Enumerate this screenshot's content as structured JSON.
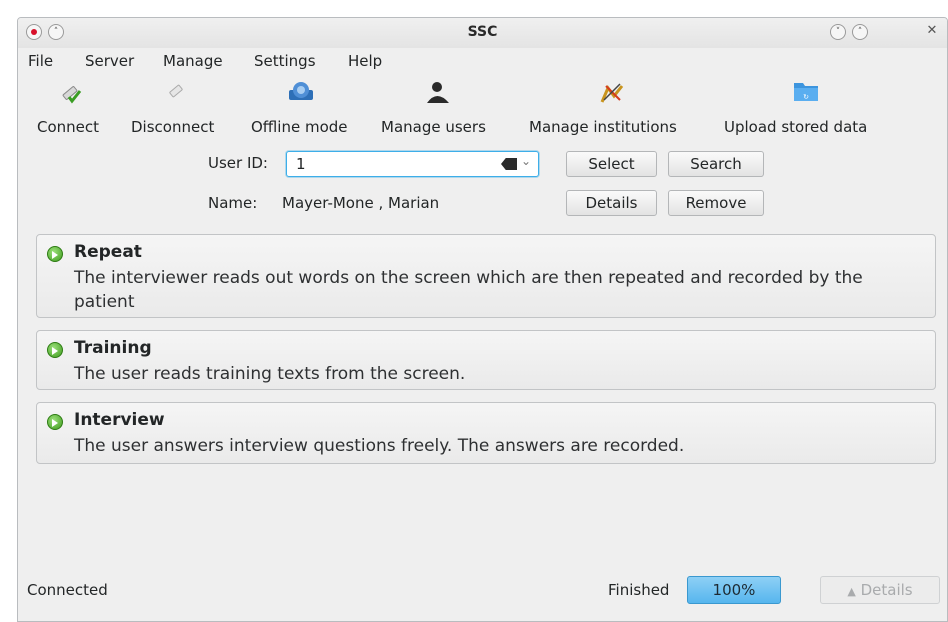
{
  "window": {
    "title": "SSC"
  },
  "menu": [
    {
      "label": "File",
      "underline": "F",
      "rest": "ile"
    },
    {
      "label": "Server",
      "underline": "e",
      "pre": "S",
      "rest": "rver"
    },
    {
      "label": "Manage",
      "underline": "M",
      "rest": "anage"
    },
    {
      "label": "Settings",
      "underline": "S",
      "rest": "ettings"
    },
    {
      "label": "Help",
      "underline": "H",
      "rest": "elp"
    }
  ],
  "toolbar": {
    "connect": "Connect",
    "disconnect": "Disconnect",
    "offline_mode": "Offline mode",
    "manage_users": "Manage users",
    "manage_institutions": "Manage institutions",
    "upload_stored_data": "Upload stored data"
  },
  "user": {
    "id_label": "User ID:",
    "id_value": "1",
    "name_label": "Name:",
    "name_value": "Mayer-Mone , Marian",
    "select_label": "Select",
    "search_label": "Search",
    "details_label": "Details",
    "remove_label": "Remove"
  },
  "tasks": [
    {
      "title": "Repeat",
      "description": "The interviewer reads out words on the screen which are then repeated and recorded by the patient"
    },
    {
      "title": "Training",
      "description": "The user reads training texts from the screen."
    },
    {
      "title": "Interview",
      "description": "The user answers interview questions freely. The answers are recorded."
    }
  ],
  "statusbar": {
    "connection": "Connected",
    "job_state": "Finished",
    "progress_text": "100%",
    "progress_value": 1.0,
    "details_label": "Details"
  },
  "colors": {
    "accent": "#3daee9",
    "progress": "#56b6ee",
    "go_icon": "#3f9b1e",
    "record": "#d8102a"
  }
}
